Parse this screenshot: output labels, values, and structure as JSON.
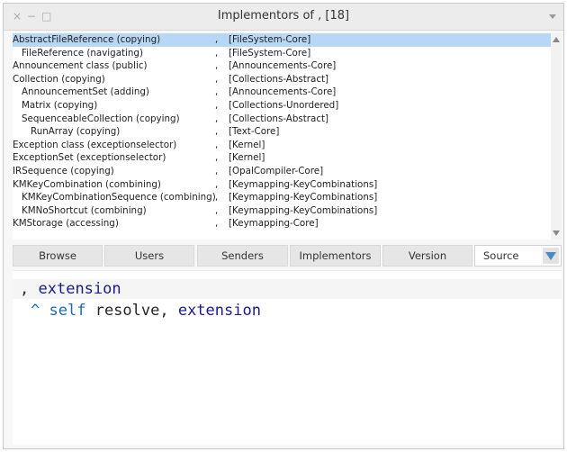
{
  "window": {
    "title": "Implementors of , [18]",
    "controls": [
      "×",
      "−",
      "□"
    ]
  },
  "results": [
    {
      "method": "AbstractFileReference (copying)",
      "sep": ",",
      "package": "[FileSystem-Core]",
      "indent": 0,
      "selected": true
    },
    {
      "method": "FileReference (navigating)",
      "sep": ",",
      "package": "[FileSystem-Core]",
      "indent": 1
    },
    {
      "method": "Announcement class (public)",
      "sep": ",",
      "package": "[Announcements-Core]",
      "indent": 0
    },
    {
      "method": "Collection (copying)",
      "sep": ",",
      "package": "[Collections-Abstract]",
      "indent": 0
    },
    {
      "method": "AnnouncementSet (adding)",
      "sep": ",",
      "package": "[Announcements-Core]",
      "indent": 1
    },
    {
      "method": "Matrix (copying)",
      "sep": ",",
      "package": "[Collections-Unordered]",
      "indent": 1
    },
    {
      "method": "SequenceableCollection (copying)",
      "sep": ",",
      "package": "[Collections-Abstract]",
      "indent": 1
    },
    {
      "method": "RunArray (copying)",
      "sep": ",",
      "package": "[Text-Core]",
      "indent": 2
    },
    {
      "method": "Exception class (exceptionselector)",
      "sep": ",",
      "package": "[Kernel]",
      "indent": 0
    },
    {
      "method": "ExceptionSet (exceptionselector)",
      "sep": ",",
      "package": "[Kernel]",
      "indent": 0
    },
    {
      "method": "IRSequence (copying)",
      "sep": ",",
      "package": "[OpalCompiler-Core]",
      "indent": 0
    },
    {
      "method": "KMKeyCombination (combining)",
      "sep": ",",
      "package": "[Keymapping-KeyCombinations]",
      "indent": 0
    },
    {
      "method": "KMKeyCombinationSequence (combining)",
      "sep": ",",
      "package": "[Keymapping-KeyCombinations]",
      "indent": 1
    },
    {
      "method": "KMNoShortcut (combining)",
      "sep": ",",
      "package": "[Keymapping-KeyCombinations]",
      "indent": 1
    },
    {
      "method": "KMStorage (accessing)",
      "sep": ",",
      "package": "[Keymapping-Core]",
      "indent": 0
    }
  ],
  "buttons": {
    "browse": "Browse",
    "users": "Users",
    "senders": "Senders",
    "implementors": "Implementors",
    "version": "Version"
  },
  "view_selector": {
    "value": "Source"
  },
  "source": {
    "line1_comma": ",",
    "line1_arg": "extension",
    "line2_caret": "^",
    "line2_self": "self",
    "line2_msg": "resolve,",
    "line2_arg": "extension"
  }
}
